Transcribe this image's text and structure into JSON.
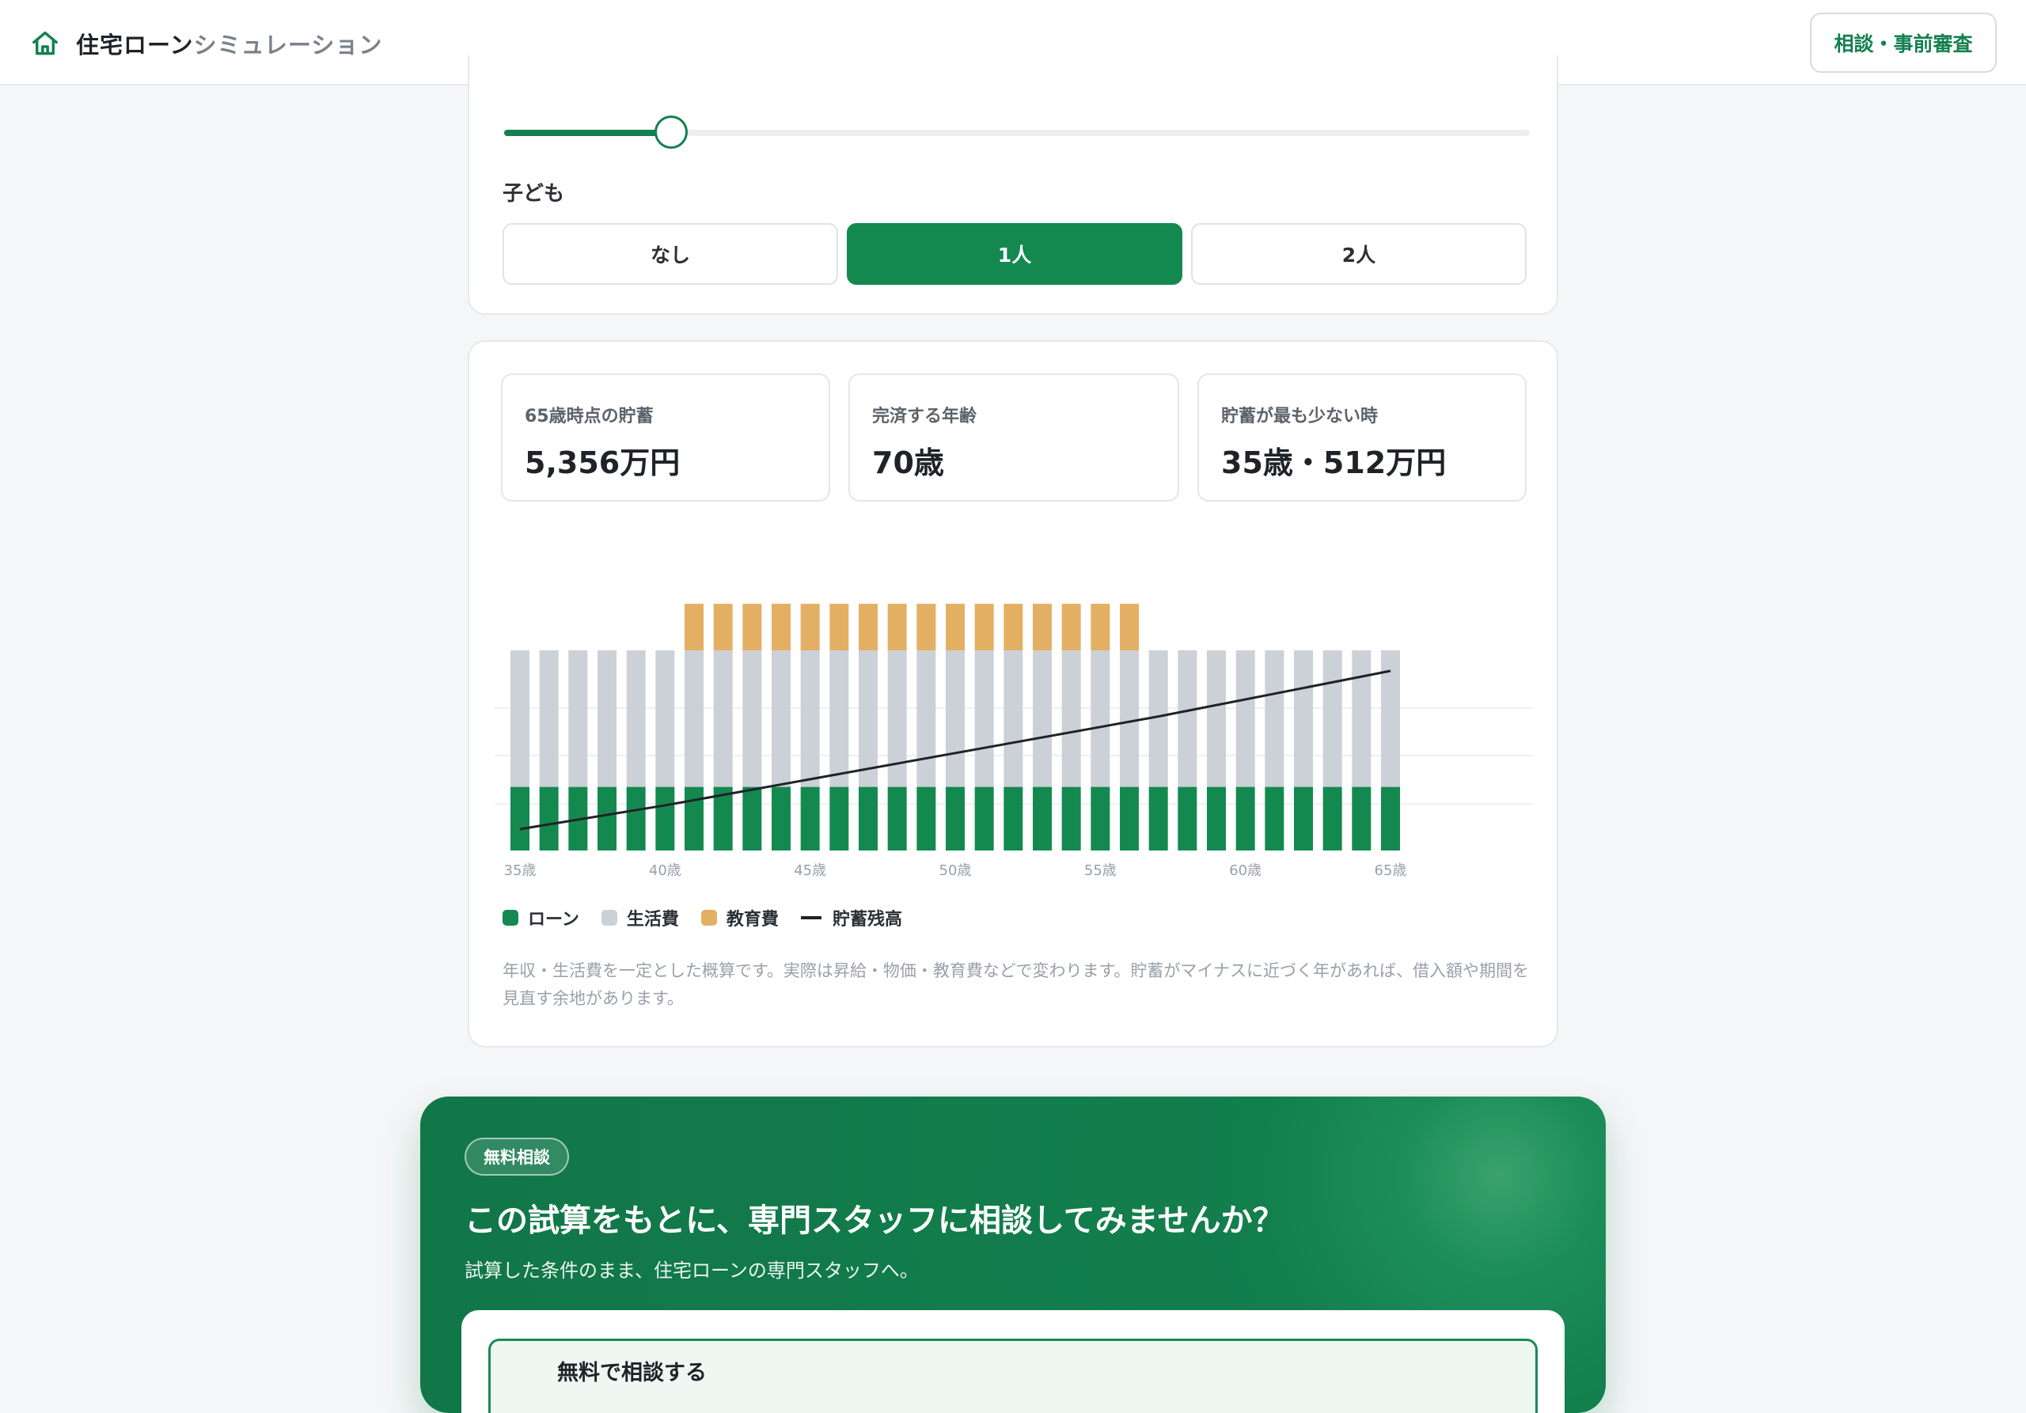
{
  "header": {
    "title_main": "住宅ローン",
    "title_sub": "シミュレーション",
    "consult_button": "相談・事前審査"
  },
  "slider": {
    "value_fraction": 0.163
  },
  "children": {
    "label": "子ども",
    "options": [
      "なし",
      "1人",
      "2人"
    ],
    "selected": "1人"
  },
  "stats": [
    {
      "label": "65歳時点の貯蓄",
      "value": "5,356万円"
    },
    {
      "label": "完済する年齢",
      "value": "70歳"
    },
    {
      "label": "貯蓄が最も少ない時",
      "value": "35歳・512万円"
    }
  ],
  "chart_data": {
    "type": "bar",
    "stacked": true,
    "categories": [
      "35歳",
      "36歳",
      "37歳",
      "38歳",
      "39歳",
      "40歳",
      "41歳",
      "42歳",
      "43歳",
      "44歳",
      "45歳",
      "46歳",
      "47歳",
      "48歳",
      "49歳",
      "50歳",
      "51歳",
      "52歳",
      "53歳",
      "54歳",
      "55歳",
      "56歳",
      "57歳",
      "58歳",
      "59歳",
      "60歳",
      "61歳",
      "62歳",
      "63歳",
      "64歳",
      "65歳"
    ],
    "tick_labels": [
      "35歳",
      "40歳",
      "45歳",
      "50歳",
      "55歳",
      "60歳",
      "65歳"
    ],
    "series": [
      {
        "name": "ローン",
        "color": "#14894f",
        "values": [
          82,
          82,
          82,
          82,
          82,
          82,
          82,
          82,
          82,
          82,
          82,
          82,
          82,
          82,
          82,
          82,
          82,
          82,
          82,
          82,
          82,
          82,
          82,
          82,
          82,
          82,
          82,
          82,
          82,
          82,
          82
        ]
      },
      {
        "name": "生活費",
        "color": "#ccd1d7",
        "values": [
          176,
          176,
          176,
          176,
          176,
          176,
          176,
          176,
          176,
          176,
          176,
          176,
          176,
          176,
          176,
          176,
          176,
          176,
          176,
          176,
          176,
          176,
          176,
          176,
          176,
          176,
          176,
          176,
          176,
          176,
          176
        ]
      },
      {
        "name": "教育費",
        "color": "#e3b063",
        "values": [
          0,
          0,
          0,
          0,
          0,
          0,
          60,
          60,
          60,
          60,
          60,
          60,
          60,
          60,
          60,
          60,
          60,
          60,
          60,
          60,
          60,
          60,
          0,
          0,
          0,
          0,
          0,
          0,
          0,
          0,
          0
        ]
      }
    ],
    "line": {
      "name": "貯蓄残高",
      "color": "#1f2328",
      "x": [
        "35歳",
        "40歳",
        "57歳",
        "65歳"
      ],
      "y": [
        512,
        1240,
        3960,
        5356
      ]
    },
    "ylim_bars": [
      0,
      400
    ],
    "ylim_line": [
      0,
      6000
    ]
  },
  "legend": [
    {
      "label": "ローン",
      "color": "#14894f"
    },
    {
      "label": "生活費",
      "color": "#ccd1d7"
    },
    {
      "label": "教育費",
      "color": "#e3b063"
    },
    {
      "label": "貯蓄残高",
      "color": "#1f2328"
    }
  ],
  "note": "年収・生活費を一定とした概算です。実際は昇給・物価・教育費などで変わります。貯蓄がマイナスに近づく年があれば、借入額や期間を見直す余地があります。",
  "cta": {
    "badge": "無料相談",
    "title": "この試算をもとに、専門スタッフに相談してみませんか？",
    "subtitle": "試算した条件のまま、住宅ローンの専門スタッフへ。",
    "button": "無料で相談する"
  }
}
